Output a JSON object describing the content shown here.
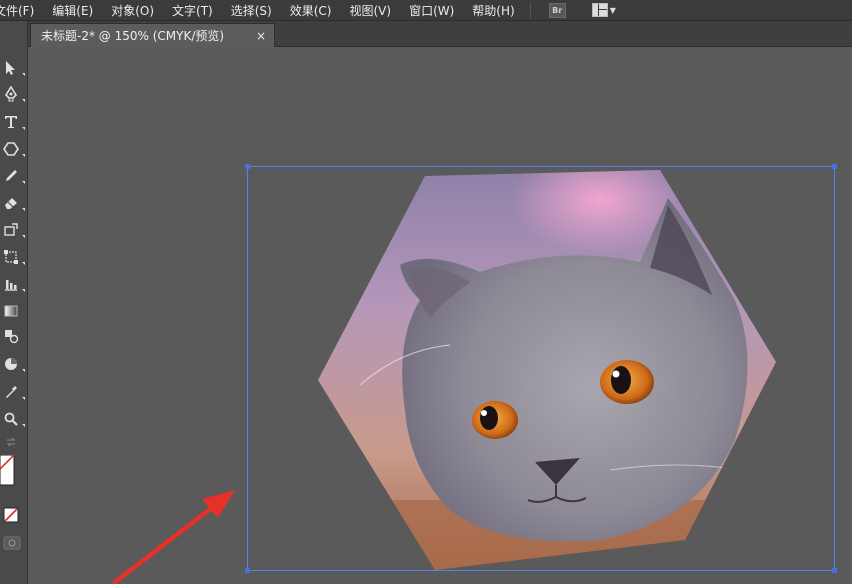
{
  "menu": {
    "items": [
      "文件(F)",
      "编辑(E)",
      "对象(O)",
      "文字(T)",
      "选择(S)",
      "效果(C)",
      "视图(V)",
      "窗口(W)",
      "帮助(H)"
    ],
    "bridge_label": "Br"
  },
  "document": {
    "tab_title": "未标题-2* @ 150% (CMYK/预览)",
    "close_glyph": "×"
  },
  "icons": {
    "selection": "selection-arrow-icon",
    "pen": "pen-icon",
    "type": "type-icon",
    "shape": "polygon-icon",
    "pencil": "pencil-icon",
    "eraser": "eraser-icon",
    "rotate": "rotate-icon",
    "free-transform": "free-transform-icon",
    "graph": "graph-icon",
    "gradient": "gradient-icon",
    "blend": "blend-icon",
    "live-paint": "live-paint-icon",
    "eyedropper": "eyedropper-icon",
    "zoom": "zoom-icon",
    "swap": "swap-icon",
    "fill-stroke": "fill-stroke-icon",
    "none-swatch": "none-swatch-icon",
    "screen-mode": "screen-mode-icon"
  },
  "colors": {
    "selection": "#5a7fe6",
    "arrow": "#e8302a",
    "canvas": "#5a5a5a"
  }
}
